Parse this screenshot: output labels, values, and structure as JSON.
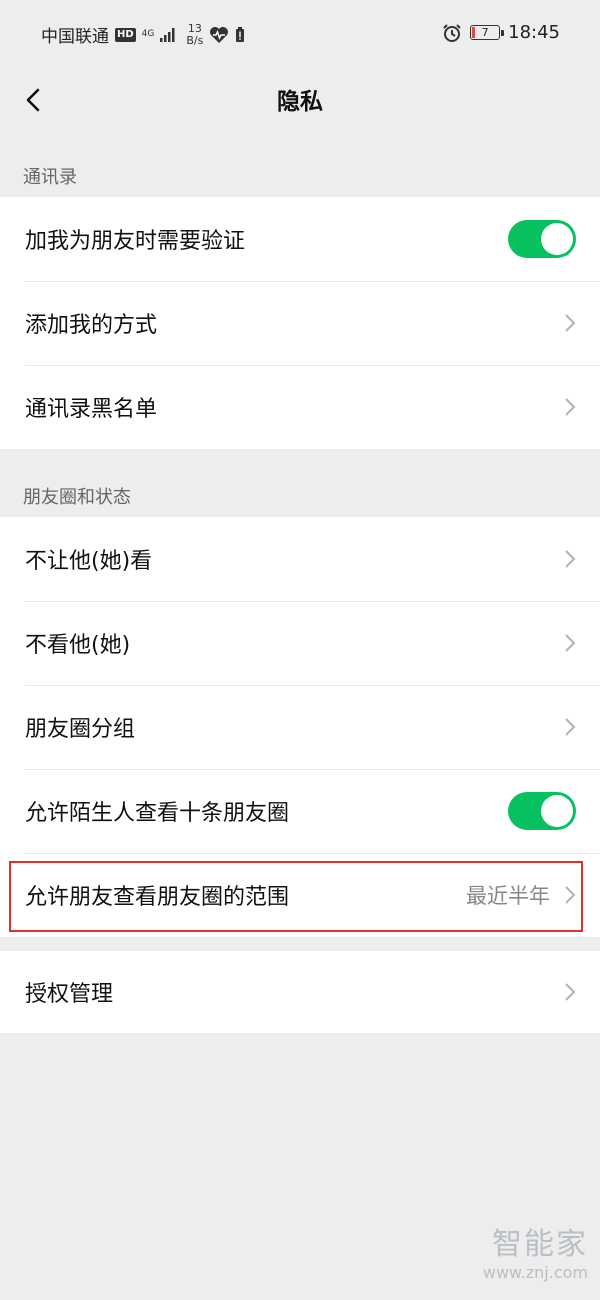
{
  "status_bar": {
    "carrier": "中国联通",
    "hd_badge": "HD",
    "network": "4G",
    "speed_value": "13",
    "speed_unit": "B/s",
    "battery_level": "7",
    "time": "18:45"
  },
  "nav": {
    "title": "隐私",
    "back_icon": "chevron-left-icon"
  },
  "sections": {
    "contacts_label": "通讯录",
    "moments_label": "朋友圈和状态"
  },
  "contacts_items": {
    "verify_label": "加我为朋友时需要验证",
    "verify_on": true,
    "add_methods_label": "添加我的方式",
    "blacklist_label": "通讯录黑名单"
  },
  "moments_items": {
    "dont_let_see_label": "不让他(她)看",
    "dont_see_label": "不看他(她)",
    "groups_label": "朋友圈分组",
    "strangers_label": "允许陌生人查看十条朋友圈",
    "strangers_on": true,
    "range_label": "允许朋友查看朋友圈的范围",
    "range_value": "最近半年"
  },
  "auth_items": {
    "auth_label": "授权管理"
  },
  "colors": {
    "toggle_on": "#07c160",
    "highlight": "#e0302a",
    "background": "#ededed"
  },
  "watermark": {
    "title": "智能家",
    "url": "www.znj.com"
  }
}
